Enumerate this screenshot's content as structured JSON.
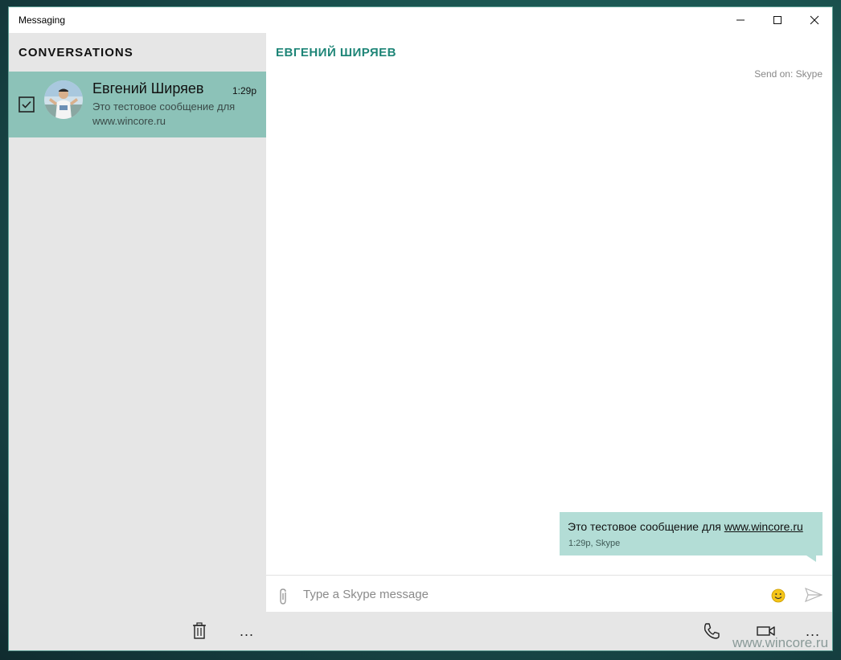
{
  "window": {
    "title": "Messaging"
  },
  "sidebar": {
    "header": "CONVERSATIONS",
    "conversations": [
      {
        "name": "Евгений Ширяев",
        "time": "1:29p",
        "preview": "Это тестовое сообщение для www.wincore.ru",
        "selected": true
      }
    ]
  },
  "chat": {
    "title": "ЕВГЕНИЙ ШИРЯЕВ",
    "send_on": "Send on: Skype",
    "messages": [
      {
        "text_prefix": "Это тестовое сообщение для ",
        "link": "www.wincore.ru",
        "meta": "1:29p, Skype"
      }
    ]
  },
  "composer": {
    "placeholder": "Type a Skype message"
  },
  "toolbar": {
    "more_left": "...",
    "more_right": "..."
  },
  "watermark": "www.wincore.ru",
  "colors": {
    "accent": "#1e8577",
    "selected_row": "#8cc2b8",
    "bubble": "#b3ddd6",
    "sidebar_bg": "#e6e6e6"
  },
  "icons": {
    "window_minimize": "minimize-icon",
    "window_maximize": "maximize-icon",
    "window_close": "close-icon",
    "checkbox": "checkbox-checked-icon",
    "attach": "paperclip-icon",
    "emoji": "smiley-icon",
    "send": "send-icon",
    "delete": "trash-icon",
    "call": "phone-icon",
    "video": "video-camera-icon"
  }
}
